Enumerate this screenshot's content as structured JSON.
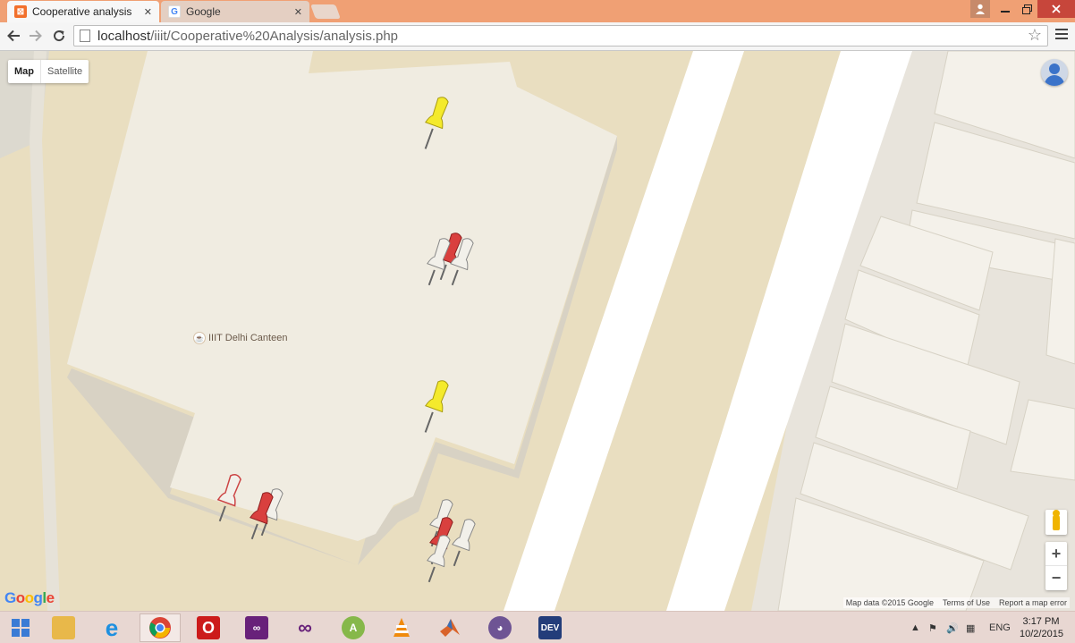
{
  "browser": {
    "tabs": [
      {
        "title": "Cooperative analysis",
        "active": true,
        "icon": "xampp-icon"
      },
      {
        "title": "Google",
        "active": false,
        "icon": "google-icon"
      }
    ],
    "close_glyph": "✕",
    "url_host": "localhost",
    "url_path": "/iiit/Cooperative%20Analysis/analysis.php"
  },
  "map": {
    "type_options": [
      "Map",
      "Satellite"
    ],
    "selected_type": "Map",
    "poi_label": "IIIT Delhi Canteen",
    "logo_letters": [
      {
        "ch": "G",
        "color": "#4285f4"
      },
      {
        "ch": "o",
        "color": "#ea4335"
      },
      {
        "ch": "o",
        "color": "#fbbc05"
      },
      {
        "ch": "g",
        "color": "#4285f4"
      },
      {
        "ch": "l",
        "color": "#34a853"
      },
      {
        "ch": "e",
        "color": "#ea4335"
      }
    ],
    "attribution": {
      "map_data": "Map data ©2015 Google",
      "terms": "Terms of Use",
      "report": "Report a map error"
    },
    "zoom_in": "+",
    "zoom_out": "−",
    "pins": [
      {
        "color": "yellow",
        "count": 1
      },
      {
        "color": "white",
        "count": 2
      },
      {
        "color": "red",
        "count": 1
      },
      {
        "color": "yellow",
        "count": 1
      },
      {
        "color": "white",
        "count": 2
      },
      {
        "color": "red",
        "count": 2
      },
      {
        "color": "white",
        "count": 4
      },
      {
        "color": "red",
        "count": 2
      }
    ]
  },
  "taskbar": {
    "apps": [
      "start",
      "file-explorer",
      "internet-explorer",
      "chrome",
      "opera",
      "visual-studio",
      "visual-studio",
      "android-studio",
      "vlc",
      "matlab",
      "github",
      "dev-cpp"
    ],
    "dev_label": "DEV",
    "language": "ENG",
    "time": "3:17 PM",
    "date": "10/2/2015"
  }
}
